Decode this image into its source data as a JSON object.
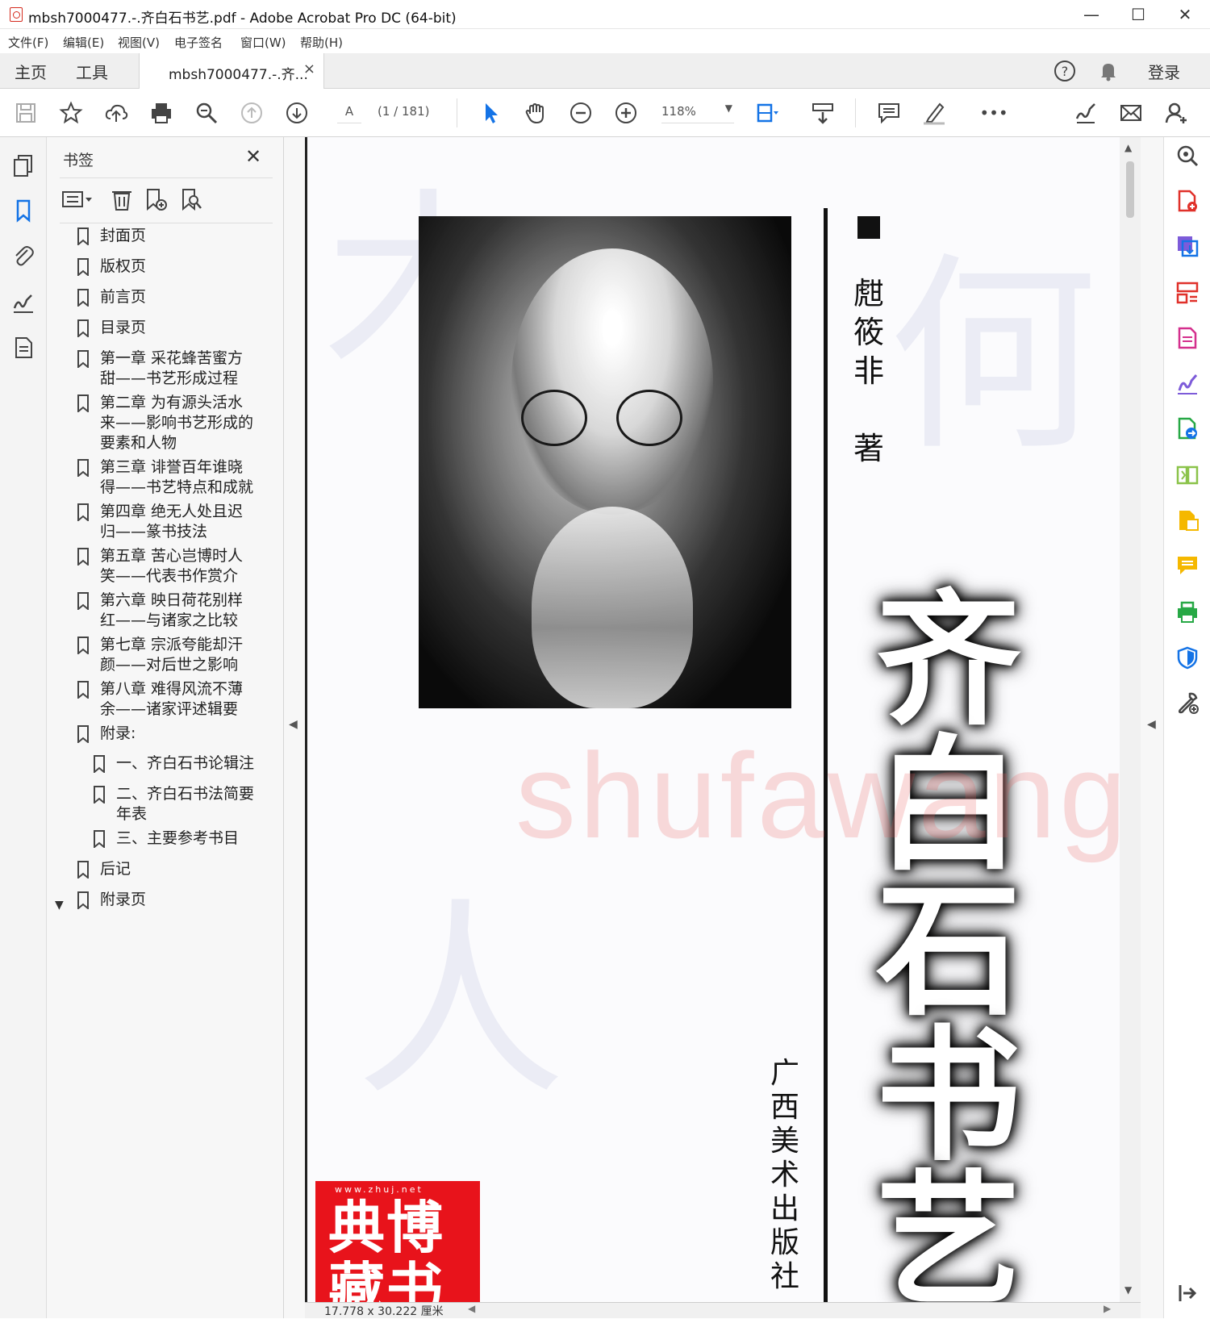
{
  "window": {
    "title": "mbsh7000477.-.齐白石书艺.pdf - Adobe Acrobat Pro DC (64-bit)",
    "minimize": "—",
    "maximize": "☐",
    "close": "✕"
  },
  "menu": [
    "文件(F)",
    "编辑(E)",
    "视图(V)",
    "电子签名",
    "窗口(W)",
    "帮助(H)"
  ],
  "tabs": {
    "home": "主页",
    "tools": "工具",
    "document": "mbsh7000477.-.齐...",
    "doc_close": "×",
    "login": "登录"
  },
  "toolbar": {
    "page_input": "A",
    "page_count": "(1 / 181)",
    "zoom": "118%",
    "more": "•••"
  },
  "bookmarks_panel": {
    "title": "书签",
    "close": "✕",
    "items": [
      {
        "label": "封面页",
        "level": 0
      },
      {
        "label": "版权页",
        "level": 0
      },
      {
        "label": "前言页",
        "level": 0
      },
      {
        "label": "目录页",
        "level": 0
      },
      {
        "label": "第一章 采花蜂苦蜜方甜——书艺形成过程",
        "level": 0
      },
      {
        "label": "第二章 为有源头活水来——影响书艺形成的要素和人物",
        "level": 0
      },
      {
        "label": "第三章 诽誉百年谁晓得——书艺特点和成就",
        "level": 0
      },
      {
        "label": "第四章 绝无人处且迟归——篆书技法",
        "level": 0
      },
      {
        "label": "第五章 苦心岂博时人笑——代表书作赏介",
        "level": 0
      },
      {
        "label": "第六章 映日荷花别样红——与诸家之比较",
        "level": 0
      },
      {
        "label": "第七章 宗派夸能却汗颜——对后世之影响",
        "level": 0
      },
      {
        "label": "第八章 难得风流不薄余——诸家评述辑要",
        "level": 0
      },
      {
        "label": "附录:",
        "level": 0,
        "expanded": true
      },
      {
        "label": "一、齐白石书论辑注",
        "level": 1
      },
      {
        "label": "二、齐白石书法简要年表",
        "level": 1
      },
      {
        "label": "三、主要参考书目",
        "level": 1
      },
      {
        "label": "后记",
        "level": 0
      },
      {
        "label": "附录页",
        "level": 0
      }
    ]
  },
  "page": {
    "author_name": "甝筱非",
    "author_suffix": "著",
    "book_title": "齐白石书艺",
    "publisher": "广西美术出版社",
    "stamp_url": "www.zhuj.net",
    "stamp_chars": "典博 藏书",
    "watermark": "shufawang.cN"
  },
  "status": {
    "page_size": "17.778 x 30.222 厘米"
  },
  "colors": {
    "accent": "#1473e6",
    "stamp_red": "#e8131b",
    "acrobat_red": "#d52b1e"
  }
}
